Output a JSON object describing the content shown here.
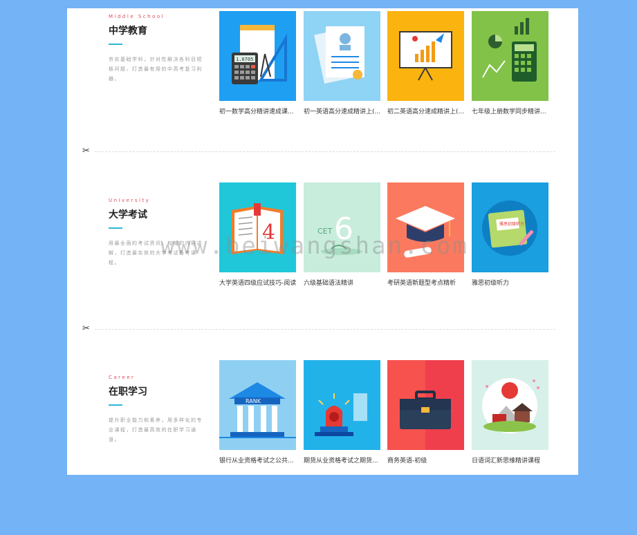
{
  "sections": [
    {
      "en": "Middle School",
      "zh": "中学教育",
      "desc": "夯实基础学科，针对性解决各科目短板问题，打造最有用的中高考复习利器。",
      "courses": [
        {
          "title": "初一数学高分精讲速成课..."
        },
        {
          "title": "初一英语高分速成精讲上(..."
        },
        {
          "title": "初二英语高分速成精讲上(..."
        },
        {
          "title": "七年级上册数学同步精讲..."
        }
      ]
    },
    {
      "en": "University",
      "zh": "大学考试",
      "desc": "用最全面的考试资讯，权威的内容讲解，打造最实效的大学考试备考课程。",
      "courses": [
        {
          "title": "大学英语四级应试技巧-阅读"
        },
        {
          "title": "六级基础语法精讲"
        },
        {
          "title": "考研英语新题型考点精析"
        },
        {
          "title": "雅思初级听力"
        }
      ]
    },
    {
      "en": "Career",
      "zh": "在职学习",
      "desc": "提升职业能力和素养，用多样化的专业课程，打造最高效的在职学习通道。",
      "courses": [
        {
          "title": "银行从业资格考试之公共..."
        },
        {
          "title": "期货从业资格考试之期货..."
        },
        {
          "title": "商务英语-初级"
        },
        {
          "title": "日语词汇新思维精讲课程"
        }
      ]
    }
  ],
  "thumb_text": {
    "calc_display": "1.0705",
    "cet_label": "CET",
    "cet_number": "6",
    "four_label": "4",
    "ielts_label": "雅思初级听力",
    "bank_label": "RANK"
  },
  "watermark": "www.beiwangshan.com",
  "icons": {
    "divider": "scissors-icon"
  },
  "colors": {
    "background": "#74b3f6",
    "accent_en": "#e04a5a",
    "accent_underline": "#2cb8d6"
  }
}
